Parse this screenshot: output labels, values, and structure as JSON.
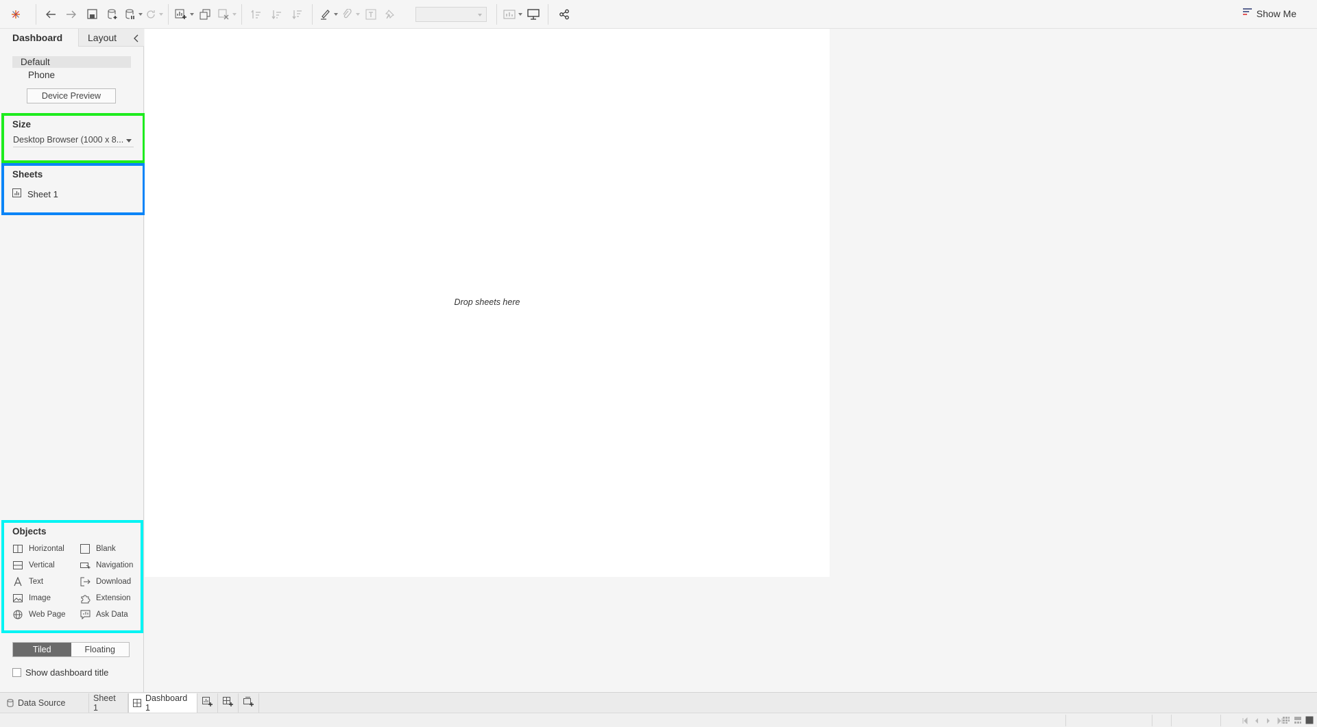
{
  "toolbar": {
    "icons": [
      "tableau-logo-icon",
      "undo-icon",
      "redo-icon",
      "save-icon",
      "new-datasource-icon",
      "pause-updates-icon",
      "refresh-icon",
      "new-worksheet-icon",
      "duplicate-icon",
      "clear-icon",
      "swap-icon",
      "sort-asc-icon",
      "sort-desc-icon",
      "highlight-icon",
      "group-icon",
      "labels-icon",
      "pin-icon",
      "fit-select",
      "show-cards-icon",
      "presentation-icon",
      "share-icon"
    ],
    "show_me_label": "Show Me"
  },
  "left_panel": {
    "tabs": {
      "dashboard": "Dashboard",
      "layout": "Layout"
    },
    "devices": {
      "default": "Default",
      "phone": "Phone"
    },
    "device_preview_label": "Device Preview",
    "size": {
      "title": "Size",
      "value": "Desktop Browser (1000 x 8..."
    },
    "sheets": {
      "title": "Sheets",
      "items": [
        "Sheet 1"
      ]
    },
    "objects": {
      "title": "Objects",
      "items": {
        "horizontal": "Horizontal",
        "blank": "Blank",
        "vertical": "Vertical",
        "navigation": "Navigation",
        "text": "Text",
        "download": "Download",
        "image": "Image",
        "extension": "Extension",
        "web_page": "Web Page",
        "ask_data": "Ask Data"
      }
    },
    "layout_toggle": {
      "tiled": "Tiled",
      "floating": "Floating",
      "selected": "Tiled"
    },
    "show_title_label": "Show dashboard title",
    "show_title_checked": false
  },
  "canvas": {
    "drop_text": "Drop sheets here"
  },
  "sheet_tabs": {
    "data_source": "Data Source",
    "sheet1": "Sheet 1",
    "dashboard1": "Dashboard 1",
    "active": "Dashboard 1"
  },
  "colors": {
    "size_highlight": "#1eeb1e",
    "sheets_highlight": "#0b84f7",
    "objects_highlight": "#00f4f4"
  }
}
